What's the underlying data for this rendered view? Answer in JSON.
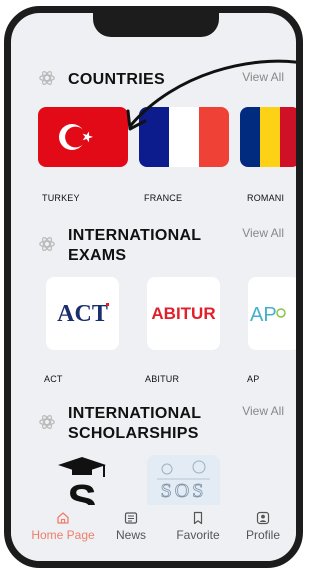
{
  "sections": [
    {
      "title": "COUNTRIES",
      "view_all": "View All",
      "items": [
        {
          "label": "TURKEY"
        },
        {
          "label": "FRANCE"
        },
        {
          "label": "ROMANI"
        }
      ]
    },
    {
      "title": "INTERNATIONAL EXAMS",
      "view_all": "View All",
      "items": [
        {
          "label": "ACT",
          "logo": "ACT"
        },
        {
          "label": "ABITUR",
          "logo": "ABITUR"
        },
        {
          "label": "AP",
          "logo": "AP"
        }
      ]
    },
    {
      "title": "INTERNATIONAL SCHOLARSHIPS",
      "view_all": "View All",
      "items": [
        {
          "logo": "S"
        },
        {
          "logo": "SOS"
        }
      ]
    }
  ],
  "nav": [
    {
      "label": "Home Page",
      "icon": "home-icon",
      "active": true
    },
    {
      "label": "News",
      "icon": "news-icon",
      "active": false
    },
    {
      "label": "Favorite",
      "icon": "bookmark-icon",
      "active": false
    },
    {
      "label": "Profile",
      "icon": "profile-icon",
      "active": false
    }
  ],
  "colors": {
    "accent": "#f07d6d",
    "turkey_red": "#e30a17",
    "france_blue": "#0c1c8c",
    "france_red": "#ef4135",
    "romania_yellow": "#fcd116",
    "romania_blue": "#002b7f"
  }
}
